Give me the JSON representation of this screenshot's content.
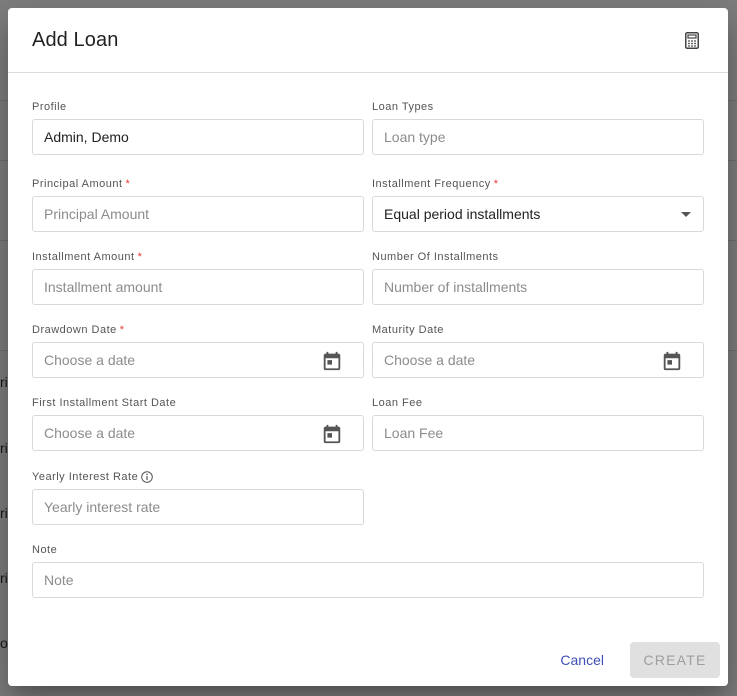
{
  "backdrop": {
    "fragments": [
      "ri",
      "ri",
      "ri",
      "ri",
      "oa"
    ]
  },
  "dialog": {
    "title": "Add Loan",
    "header_icon": "calculator-icon"
  },
  "fields": {
    "profile": {
      "label": "Profile",
      "value": "Admin, Demo"
    },
    "loan_types": {
      "label": "Loan Types",
      "placeholder": "Loan type"
    },
    "principal_amount": {
      "label": "Principal Amount",
      "required": "*",
      "placeholder": "Principal Amount"
    },
    "installment_frequency": {
      "label": "Installment Frequency",
      "required": "*",
      "value": "Equal period installments"
    },
    "installment_amount": {
      "label": "Installment Amount",
      "required": "*",
      "placeholder": "Installment amount"
    },
    "number_of_installments": {
      "label": "Number Of Installments",
      "placeholder": "Number of installments"
    },
    "drawdown_date": {
      "label": "Drawdown Date",
      "required": "*",
      "placeholder": "Choose a date"
    },
    "maturity_date": {
      "label": "Maturity Date",
      "placeholder": "Choose a date"
    },
    "first_installment_start_date": {
      "label": "First Installment Start Date",
      "placeholder": "Choose a date"
    },
    "loan_fee": {
      "label": "Loan Fee",
      "placeholder": "Loan Fee"
    },
    "yearly_interest_rate": {
      "label": "Yearly Interest Rate",
      "placeholder": "Yearly interest rate"
    },
    "note": {
      "label": "Note",
      "placeholder": "Note"
    }
  },
  "actions": {
    "cancel_label": "Cancel",
    "create_label": "CREATE"
  },
  "colors": {
    "accent": "#3f51b5",
    "required": "#e53935",
    "disabled_bg": "#e0e0e0",
    "disabled_text": "#9e9e9e"
  }
}
